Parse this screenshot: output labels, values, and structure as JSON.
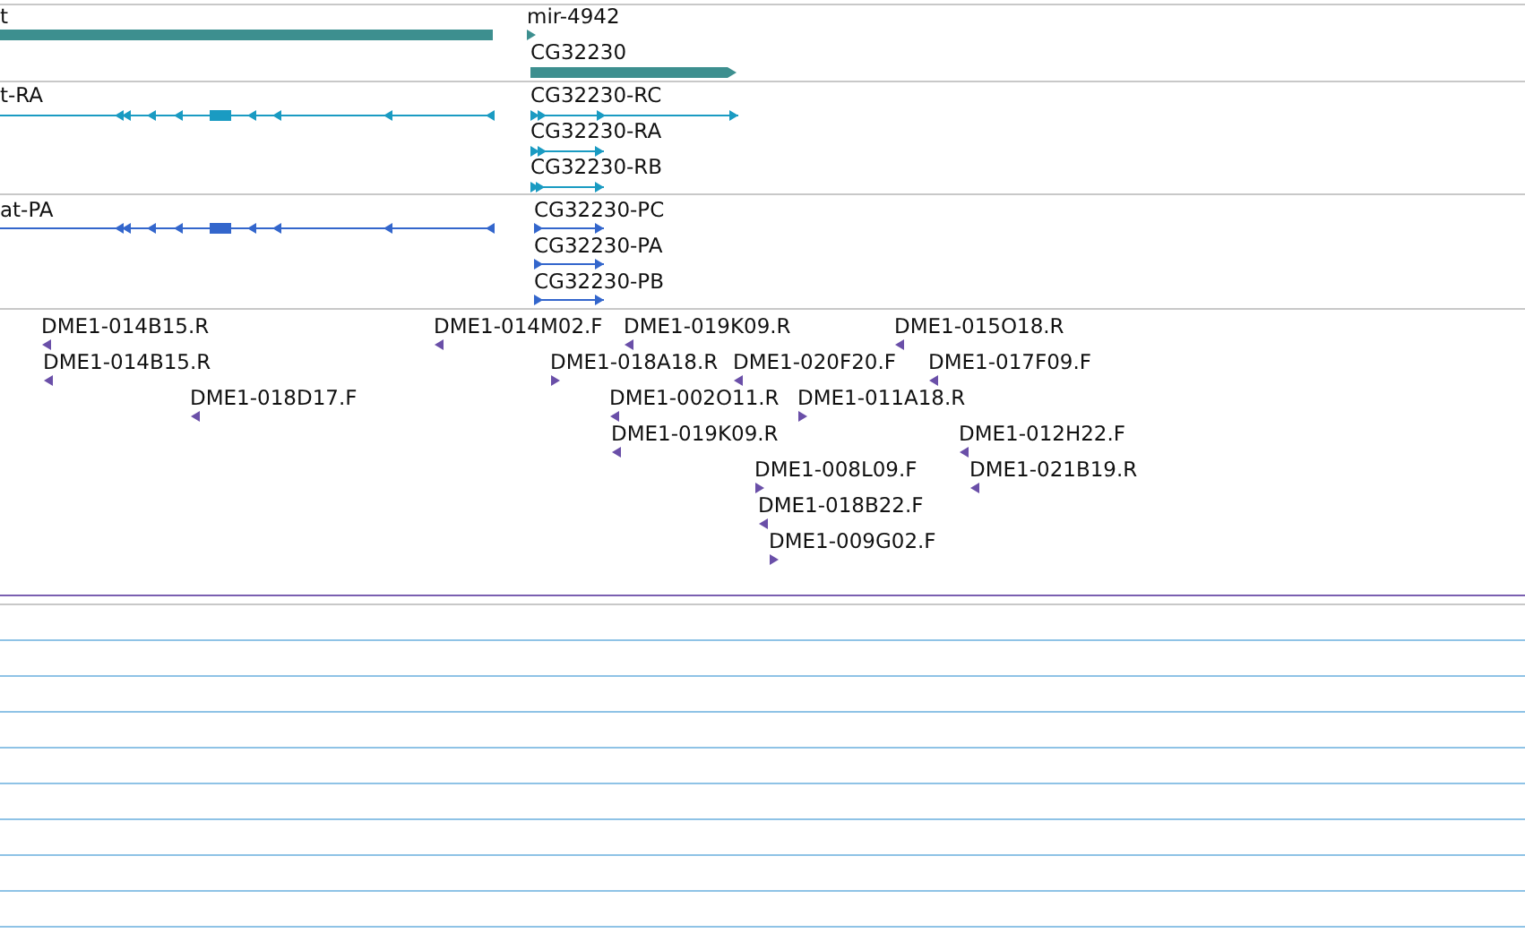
{
  "tracks": [
    {
      "kind": "gene",
      "features": [
        {
          "label": "t",
          "reverse": true
        },
        {
          "label": "mir-4942",
          "reverse": false
        },
        {
          "label": "CG32230",
          "reverse": false
        }
      ]
    },
    {
      "kind": "mrna",
      "features": [
        {
          "label": "t-RA",
          "reverse": true
        },
        {
          "label": "CG32230-RC",
          "reverse": false
        },
        {
          "label": "CG32230-RA",
          "reverse": false
        },
        {
          "label": "CG32230-RB",
          "reverse": false
        }
      ]
    },
    {
      "kind": "protein",
      "features": [
        {
          "label": "at-PA",
          "reverse": true
        },
        {
          "label": "CG32230-PC",
          "reverse": false
        },
        {
          "label": "CG32230-PA",
          "reverse": false
        },
        {
          "label": "CG32230-PB",
          "reverse": false
        }
      ]
    },
    {
      "kind": "est",
      "features": [
        {
          "label": "DME1-014B15.R",
          "reverse": true
        },
        {
          "label": "DME1-014B15.R",
          "reverse": true
        },
        {
          "label": "DME1-018D17.F",
          "reverse": true
        },
        {
          "label": "DME1-014M02.F",
          "reverse": true
        },
        {
          "label": "DME1-019K09.R",
          "reverse": true
        },
        {
          "label": "DME1-018A18.R",
          "reverse": false
        },
        {
          "label": "DME1-020F20.F",
          "reverse": true
        },
        {
          "label": "DME1-015O18.R",
          "reverse": true
        },
        {
          "label": "DME1-017F09.F",
          "reverse": true
        },
        {
          "label": "DME1-002O11.R",
          "reverse": true
        },
        {
          "label": "DME1-011A18.R",
          "reverse": false
        },
        {
          "label": "DME1-019K09.R",
          "reverse": true
        },
        {
          "label": "DME1-012H22.F",
          "reverse": true
        },
        {
          "label": "DME1-008L09.F",
          "reverse": false
        },
        {
          "label": "DME1-021B19.R",
          "reverse": true
        },
        {
          "label": "DME1-018B22.F",
          "reverse": true
        },
        {
          "label": "DME1-009G02.F",
          "reverse": false
        }
      ]
    }
  ]
}
